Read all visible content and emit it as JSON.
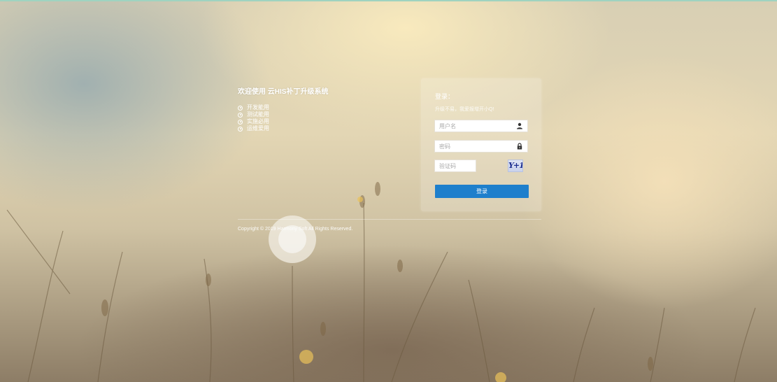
{
  "welcome": {
    "title": "欢迎使用 云HIS补丁升级系统",
    "features": [
      "开发能用",
      "测试能用",
      "实施必用",
      "运维爱用"
    ]
  },
  "login": {
    "title": "登录：",
    "subtitle": "升级不易，我爱报增开小Q!",
    "username_placeholder": "用户名",
    "password_placeholder": "密码",
    "captcha_placeholder": "验证码",
    "captcha_text": "Y+1=?",
    "submit_label": "登录"
  },
  "footer": {
    "copyright": "Copyright © 2019 Harmony Soft All Rights Reserved."
  },
  "colors": {
    "accent": "#1e7fcc",
    "top_line": "#9fd3c0"
  }
}
